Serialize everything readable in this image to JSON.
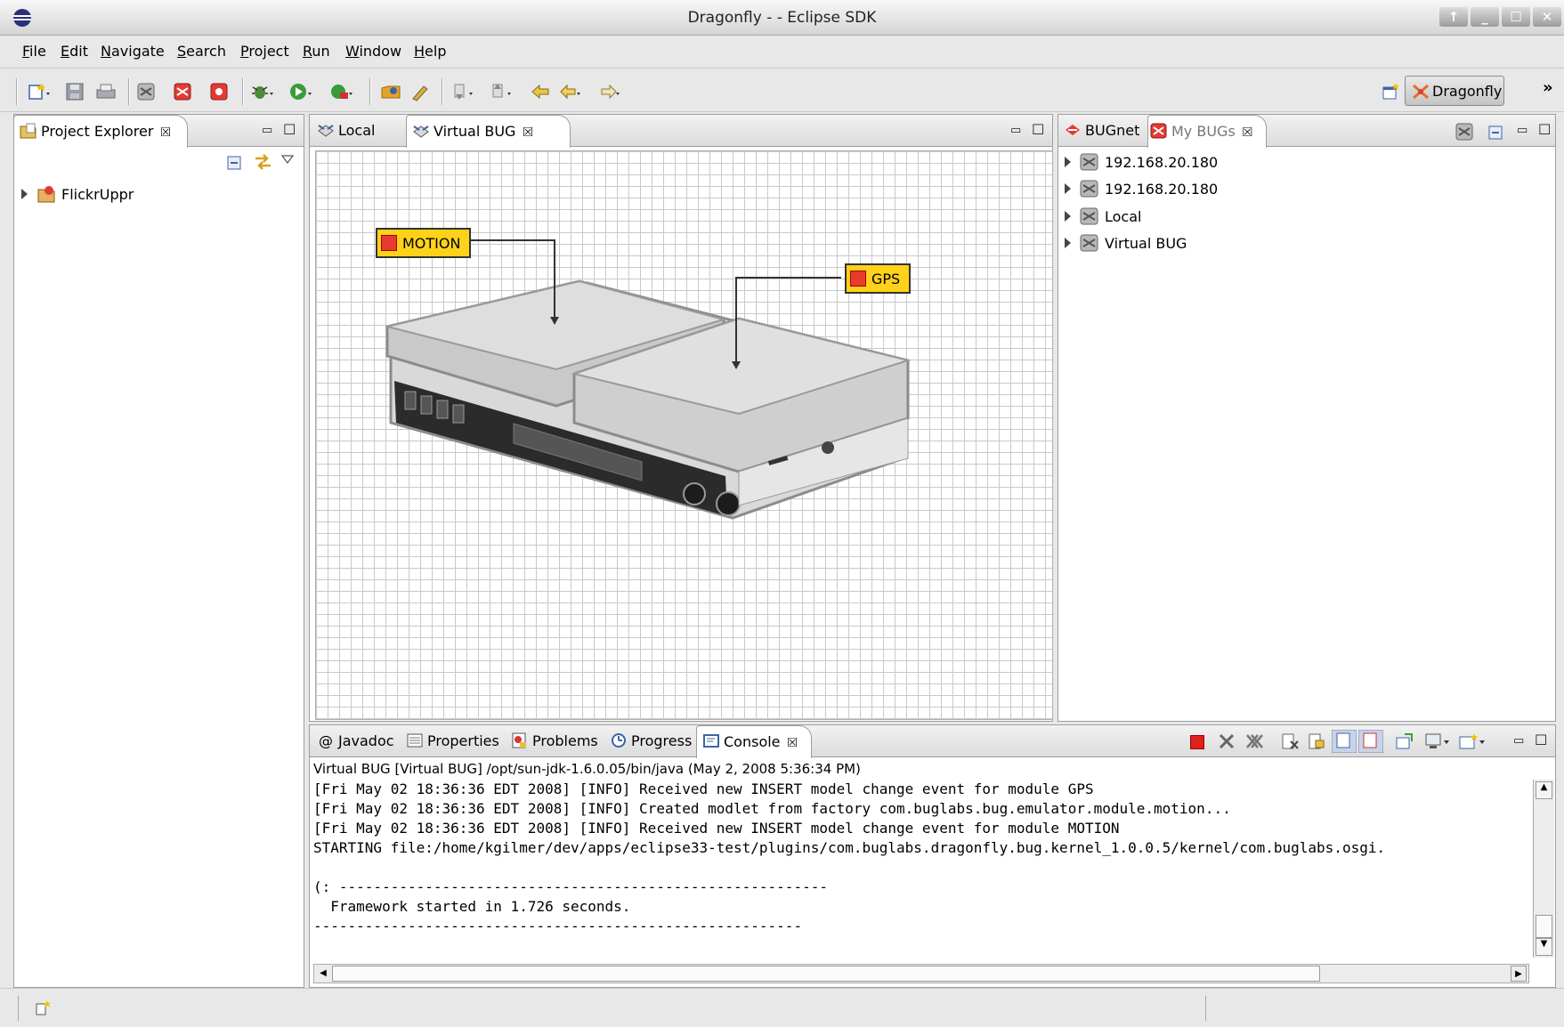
{
  "window": {
    "title": "Dragonfly -  - Eclipse SDK",
    "controls": [
      "↑",
      "_",
      "☐",
      "✕"
    ]
  },
  "menu": [
    "File",
    "Edit",
    "Navigate",
    "Search",
    "Project",
    "Run",
    "Window",
    "Help"
  ],
  "perspective": {
    "label": "Dragonfly",
    "overflow": "»"
  },
  "project_explorer": {
    "tab_label": "Project Explorer",
    "items": [
      {
        "label": "FlickrUppr"
      }
    ]
  },
  "editor": {
    "tabs": [
      {
        "label": "Local"
      },
      {
        "label": "Virtual BUG"
      }
    ],
    "active_tab": "Virtual BUG",
    "modules": [
      {
        "label": "MOTION"
      },
      {
        "label": "GPS"
      }
    ]
  },
  "bug_view": {
    "tabs": [
      {
        "label": "BUGnet"
      },
      {
        "label": "My BUGs"
      }
    ],
    "items": [
      {
        "label": "192.168.20.180"
      },
      {
        "label": "192.168.20.180"
      },
      {
        "label": "Local"
      },
      {
        "label": "Virtual BUG"
      }
    ]
  },
  "bottom": {
    "tabs": [
      {
        "label": "Javadoc",
        "glyph": "@"
      },
      {
        "label": "Properties"
      },
      {
        "label": "Problems"
      },
      {
        "label": "Progress"
      },
      {
        "label": "Console"
      }
    ],
    "active_tab": "Console",
    "console_header": "Virtual BUG [Virtual BUG] /opt/sun-jdk-1.6.0.05/bin/java (May 2, 2008 5:36:34 PM)",
    "console_lines": [
      "[Fri May 02 18:36:36 EDT 2008] [INFO] Received new INSERT model change event for module GPS",
      "[Fri May 02 18:36:36 EDT 2008] [INFO] Created modlet from factory com.buglabs.bug.emulator.module.motion...",
      "[Fri May 02 18:36:36 EDT 2008] [INFO] Received new INSERT model change event for module MOTION",
      "STARTING file:/home/kgilmer/dev/apps/eclipse33-test/plugins/com.buglabs.dragonfly.bug.kernel_1.0.0.5/kernel/com.buglabs.osgi.",
      "",
      "(: ---------------------------------------------------------",
      "  Framework started in 1.726 seconds.",
      "---------------------------------------------------------"
    ]
  },
  "colors": {
    "module_tag": "#ffd21a",
    "stop_button": "#e0201c"
  }
}
